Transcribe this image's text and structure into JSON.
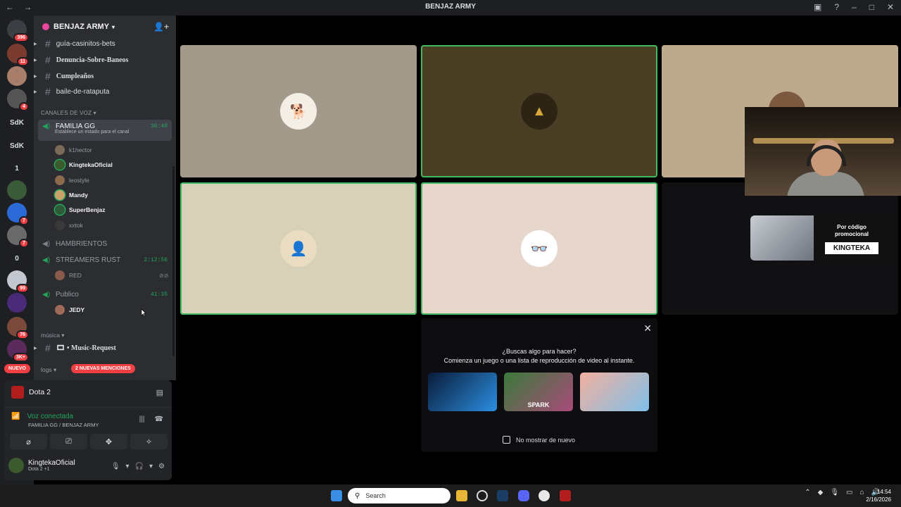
{
  "window": {
    "title": "BENJAZ ARMY",
    "back": "←",
    "forward": "→"
  },
  "servers": [
    {
      "label": "",
      "badge": "396",
      "color": "#3d3f45"
    },
    {
      "label": "",
      "badge": "11",
      "color": "#7a3b2e"
    },
    {
      "label": "",
      "badge": "",
      "color": "#a87d6a"
    },
    {
      "label": "",
      "badge": "4",
      "color": "#555"
    },
    {
      "label": "SdK",
      "badge": "",
      "color": "#1e1f22"
    },
    {
      "label": "SdK",
      "badge": "",
      "color": "#1e1f22"
    },
    {
      "label": "1",
      "badge": "",
      "color": "#1e1f22"
    },
    {
      "label": "",
      "badge": "",
      "color": "#3a5a3a"
    },
    {
      "label": "",
      "badge": "7",
      "color": "#2b6ad6"
    },
    {
      "label": "",
      "badge": "7",
      "color": "#6a6a6a"
    },
    {
      "label": "0",
      "badge": "",
      "color": "#1e1f22"
    },
    {
      "label": "",
      "badge": "99",
      "color": "#c3c8d0"
    },
    {
      "label": "",
      "badge": "",
      "color": "#4b2a7a"
    },
    {
      "label": "",
      "badge": "76",
      "color": "#7a4a3a"
    },
    {
      "label": "",
      "badge": "3K+",
      "color": "#5a2a5a"
    }
  ],
  "guild": {
    "name": "BENJAZ ARMY"
  },
  "text_channels": [
    "guía-casinitos-bets",
    "Denuncia-Sobre-Baneos",
    "Cumpleaños",
    "baile-de-rataputa"
  ],
  "voice_category": "CANALES DE VOZ",
  "voice": {
    "familia": {
      "name": "FAMILIA GG",
      "time": "36:40",
      "status": "Establece un estado para el canal"
    },
    "familia_users": [
      {
        "name": "k1hector",
        "on": false,
        "color": "#7c6a5a"
      },
      {
        "name": "KingtekaOficial",
        "on": true,
        "color": "#3b5a2d"
      },
      {
        "name": "leostyle",
        "on": false,
        "color": "#8a6a4a"
      },
      {
        "name": "Mandy",
        "on": true,
        "color": "#c9a26a"
      },
      {
        "name": "SuperBenjaz",
        "on": true,
        "color": "#2e5a3a"
      },
      {
        "name": "xxtok",
        "on": false,
        "color": "#3a3a3a"
      }
    ],
    "hambrientos": {
      "name": "HAMBRIENTOS"
    },
    "streamers": {
      "name": "STREAMERS RUST",
      "time": "2:12:56",
      "user": "RED"
    },
    "publico": {
      "name": "Publico",
      "time": "41:35",
      "user": "JEDY"
    }
  },
  "music_category": "música",
  "music_channel": "Music-Request",
  "new_label": "NUEVO",
  "logs_category": "logs",
  "mentions_label": "2 NUEVAS MENCIONES",
  "panel": {
    "game": "Dota 2",
    "voice_status": "Voz conectada",
    "voice_sub": "FAMILIA GG / BENJAZ ARMY",
    "user_name": "KingtekaOficial",
    "user_status": "Dota 2 +1"
  },
  "suggest": {
    "question": "¿Buscas algo para hacer?",
    "subtitle": "Comienza un juego o una lista de reproducción de video al instante.",
    "cards": [
      "",
      "SPARK",
      ""
    ],
    "checkbox": "No mostrar de nuevo"
  },
  "promo": {
    "line1": "Por código promocional",
    "code": "KINGTEKA"
  },
  "taskbar": {
    "search": "Search",
    "time": "14:54",
    "date": "2/16/2026"
  },
  "colors": {
    "speaking": "#3fba61",
    "accent": "#23a55a",
    "danger": "#f23f43"
  }
}
